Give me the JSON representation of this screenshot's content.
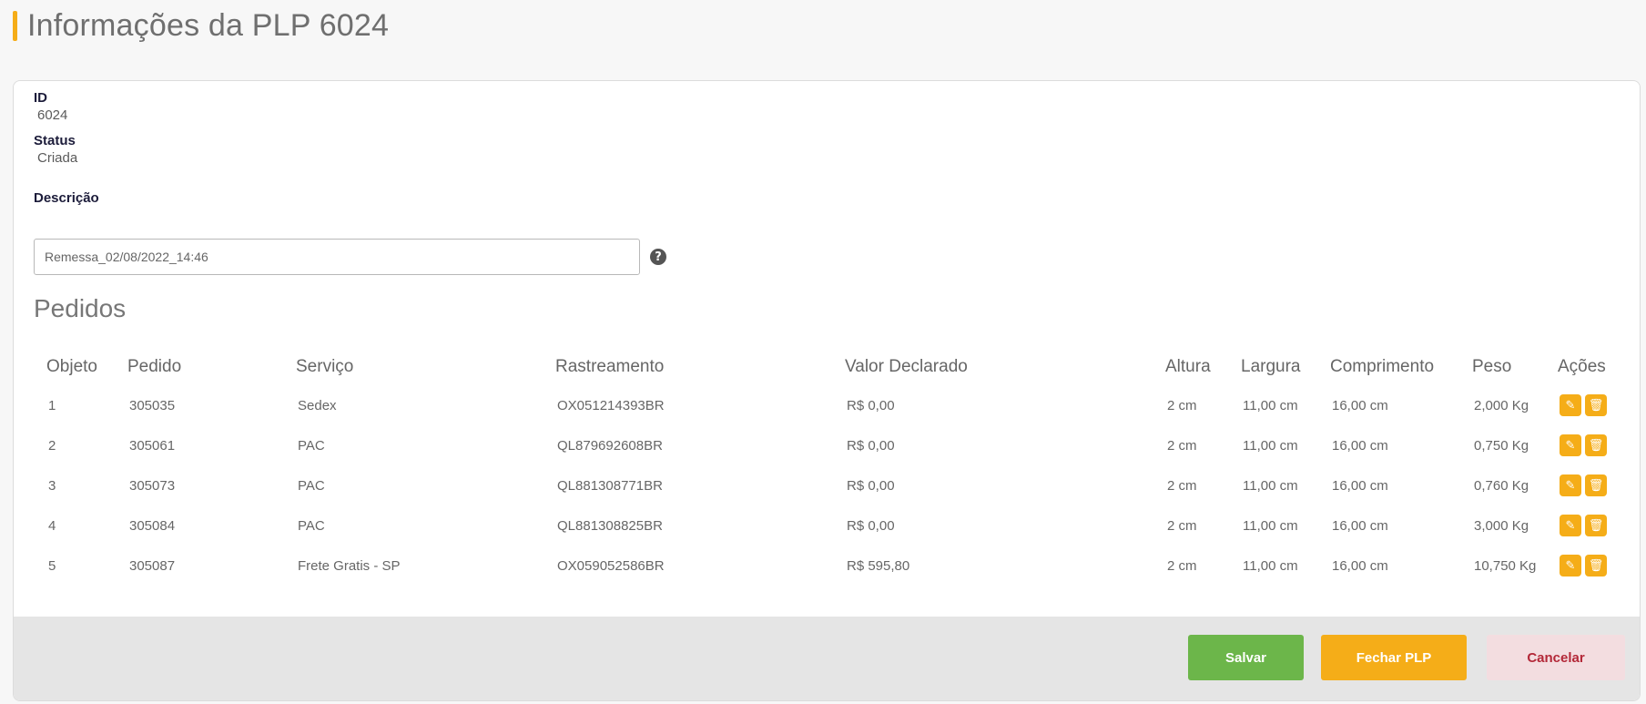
{
  "header": {
    "title": "Informações da PLP 6024"
  },
  "info": {
    "id_label": "ID",
    "id_value": "6024",
    "status_label": "Status",
    "status_value": "Criada",
    "description_label": "Descrição",
    "description_value": "Remessa_02/08/2022_14:46",
    "help_icon": "question-circle-icon"
  },
  "orders_section": {
    "title": "Pedidos",
    "columns": [
      "Objeto",
      "Pedido",
      "Serviço",
      "Rastreamento",
      "Valor Declarado",
      "Altura",
      "Largura",
      "Comprimento",
      "Peso",
      "Ações"
    ],
    "rows": [
      {
        "objeto": "1",
        "pedido": "305035",
        "servico": "Sedex",
        "rastreamento": "OX051214393BR",
        "valor": "R$ 0,00",
        "altura": "2 cm",
        "largura": "11,00 cm",
        "comprimento": "16,00 cm",
        "peso": "2,000 Kg"
      },
      {
        "objeto": "2",
        "pedido": "305061",
        "servico": "PAC",
        "rastreamento": "QL879692608BR",
        "valor": "R$ 0,00",
        "altura": "2 cm",
        "largura": "11,00 cm",
        "comprimento": "16,00 cm",
        "peso": "0,750 Kg"
      },
      {
        "objeto": "3",
        "pedido": "305073",
        "servico": "PAC",
        "rastreamento": "QL881308771BR",
        "valor": "R$ 0,00",
        "altura": "2 cm",
        "largura": "11,00 cm",
        "comprimento": "16,00 cm",
        "peso": "0,760 Kg"
      },
      {
        "objeto": "4",
        "pedido": "305084",
        "servico": "PAC",
        "rastreamento": "QL881308825BR",
        "valor": "R$ 0,00",
        "altura": "2 cm",
        "largura": "11,00 cm",
        "comprimento": "16,00 cm",
        "peso": "3,000 Kg"
      },
      {
        "objeto": "5",
        "pedido": "305087",
        "servico": "Frete Gratis - SP",
        "rastreamento": "OX059052586BR",
        "valor": "R$ 595,80",
        "altura": "2 cm",
        "largura": "11,00 cm",
        "comprimento": "16,00 cm",
        "peso": "10,750 Kg"
      }
    ],
    "action_icons": [
      "pencil-icon",
      "trash-icon"
    ]
  },
  "footer": {
    "save_label": "Salvar",
    "close_label": "Fechar PLP",
    "cancel_label": "Cancelar"
  },
  "colors": {
    "accent": "#f5ad18",
    "save": "#6cb64a",
    "cancel_bg": "#f3dde0",
    "cancel_text": "#b32838"
  }
}
